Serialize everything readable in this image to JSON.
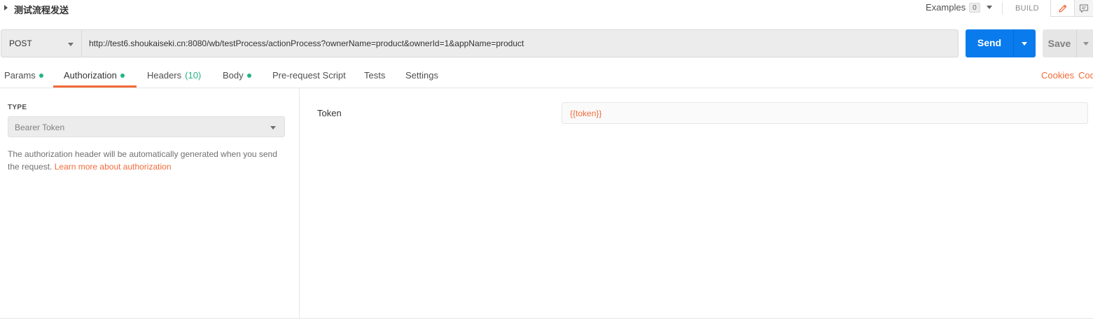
{
  "request": {
    "name": "测试流程发送",
    "method": "POST",
    "url": "http://test6.shoukaiseki.cn:8080/wb/testProcess/actionProcess?ownerName=product&ownerId=1&appName=product"
  },
  "header": {
    "examples_label": "Examples",
    "examples_count": "0",
    "build_label": "BUILD",
    "edit_icon": "pencil-icon",
    "comment_icon": "comment-icon"
  },
  "actions": {
    "send_label": "Send",
    "save_label": "Save"
  },
  "tabs": [
    {
      "label": "Params",
      "indicator": "dot"
    },
    {
      "label": "Authorization",
      "indicator": "dot",
      "active": true
    },
    {
      "label": "Headers",
      "count": "(10)"
    },
    {
      "label": "Body",
      "indicator": "dot"
    },
    {
      "label": "Pre-request Script"
    },
    {
      "label": "Tests"
    },
    {
      "label": "Settings"
    }
  ],
  "links": {
    "cookies": "Cookies",
    "code": "Cod"
  },
  "auth": {
    "type_label": "TYPE",
    "type_value": "Bearer Token",
    "description": "The authorization header will be automatically generated when you send the request.",
    "learn_more": "Learn more about authorization",
    "token_label": "Token",
    "token_value": "{{token}}"
  },
  "colors": {
    "accent": "#f26b3a",
    "send_blue": "#097bed",
    "status_green": "#26b47f"
  }
}
